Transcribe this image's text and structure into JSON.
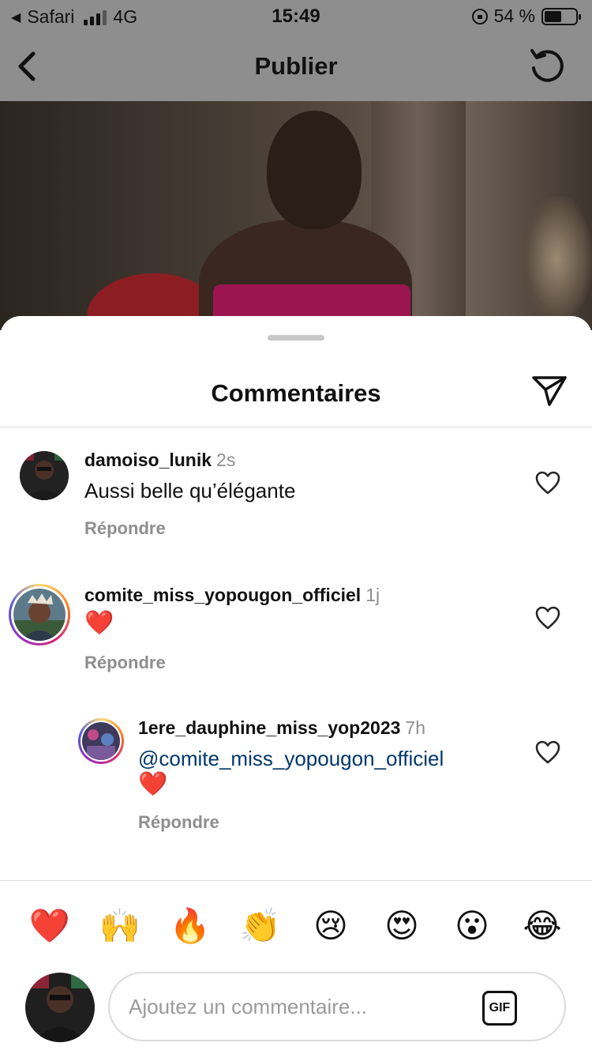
{
  "status_bar": {
    "carrier": "Safari",
    "network": "4G",
    "time": "15:49",
    "battery_text": "54 %",
    "battery_level": 0.54
  },
  "header": {
    "title": "Publier",
    "back_icon": "chevron-left-icon",
    "refresh_icon": "refresh-icon"
  },
  "sheet": {
    "title": "Commentaires",
    "share_icon": "paper-plane-icon"
  },
  "comments": [
    {
      "user": "damoiso_lunik",
      "time": "2s",
      "text": "Aussi belle qu’élégante",
      "reply": "Répondre"
    },
    {
      "user": "comite_miss_yopougon_officiel",
      "time": "1j",
      "text": "❤️",
      "reply": "Répondre"
    },
    {
      "user": "1ere_dauphine_miss_yop2023",
      "time": "7h",
      "mention": "@comite_miss_yopougon_officiel",
      "text": "❤️",
      "reply": "Répondre"
    }
  ],
  "emoji_bar": [
    "❤️",
    "🙌",
    "🔥",
    "👏",
    "😢",
    "😍",
    "😮",
    "😂"
  ],
  "composer": {
    "placeholder": "Ajoutez un commentaire...",
    "gif_label": "GIF"
  },
  "colors": {
    "mention": "#00376b",
    "secondary_text": "#8e8e8e",
    "heart_red": "#ed1c24",
    "dim_overlay": "#8e8e8e"
  }
}
